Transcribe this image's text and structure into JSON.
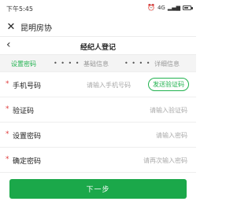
{
  "status_bar": {
    "time": "下午5:45",
    "alarm_icon": "alarm-icon",
    "network": "4G",
    "battery_level": 0.6
  },
  "app_bar": {
    "close_icon": "close-icon",
    "title": "昆明房协"
  },
  "page_header": {
    "back_icon": "chevron-left-icon",
    "title": "经纪人登记"
  },
  "steps": {
    "items": [
      {
        "label": "设置密码",
        "active": true
      },
      {
        "label": "基础信息",
        "active": false
      },
      {
        "label": "详细信息",
        "active": false
      }
    ],
    "separator": "• • • •",
    "active_color": "#21b24f"
  },
  "form": {
    "fields": [
      {
        "required_mark": "*",
        "label": "手机号码",
        "placeholder": "请输入手机号码",
        "value": ""
      },
      {
        "required_mark": "*",
        "label": "验证码",
        "placeholder": "请输入验证码",
        "value": ""
      },
      {
        "required_mark": "*",
        "label": "设置密码",
        "placeholder": "请输入密码",
        "value": ""
      },
      {
        "required_mark": "*",
        "label": "确定密码",
        "placeholder": "请再次输入密码",
        "value": ""
      }
    ],
    "send_code_label": "发送验证码"
  },
  "next_label": "下一步",
  "colors": {
    "primary": "#1ba84a",
    "required": "#e03a3a"
  }
}
